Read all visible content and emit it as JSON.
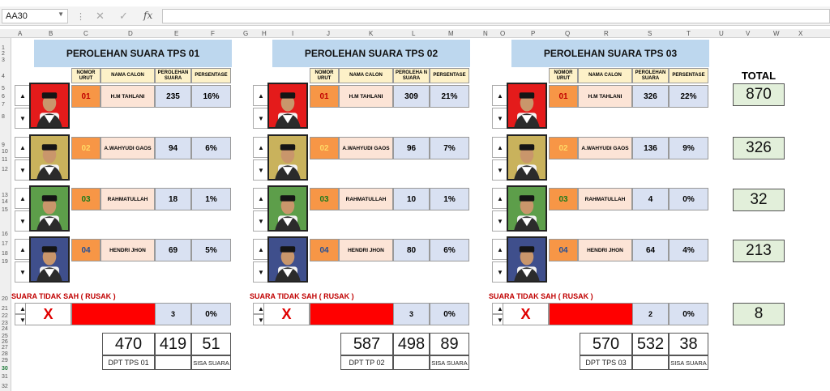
{
  "formula_bar": {
    "name_box": "AA30",
    "fx": "fx"
  },
  "columns": [
    "A",
    "B",
    "C",
    "D",
    "E",
    "F",
    "G",
    "H",
    "I",
    "J",
    "K",
    "L",
    "M",
    "N",
    "O",
    "P",
    "Q",
    "R",
    "S",
    "T",
    "U",
    "V",
    "W",
    "X"
  ],
  "rows": [
    "1",
    "2",
    "3",
    "4",
    "5",
    "6",
    "7",
    "8",
    "9",
    "10",
    "11",
    "12",
    "13",
    "14",
    "15",
    "16",
    "17",
    "18",
    "19",
    "20",
    "21",
    "22",
    "23",
    "24",
    "25",
    "26",
    "27",
    "28",
    "29",
    "30",
    "31",
    "32"
  ],
  "colors": {
    "title_bg": "#bdd7ee",
    "nomor_bg": "#f79646",
    "nama_bg": "#fce4d6",
    "value_bg": "#d9e1f2",
    "header_bg": "#fdf1c8",
    "total_bg": "#e2efda",
    "red": "#ff0000"
  },
  "blocks": [
    {
      "title": "PEROLEHAN SUARA TPS 01",
      "headers": {
        "nomor": "NOMOR URUT",
        "nama": "NAMA CALON",
        "perolehan": "PEROLEHAN SUARA",
        "persen": "PERSENTASE"
      },
      "candidates": [
        {
          "nomor": "01",
          "nama": "H.M TAHLANI",
          "suara": "235",
          "persen": "16%"
        },
        {
          "nomor": "02",
          "nama": "A.WAHYUDI GAOS",
          "suara": "94",
          "persen": "6%"
        },
        {
          "nomor": "03",
          "nama": "RAHMATULLAH",
          "suara": "18",
          "persen": "1%"
        },
        {
          "nomor": "04",
          "nama": "HENDRI JHON",
          "suara": "69",
          "persen": "5%"
        }
      ],
      "rusak_label": "SUARA TIDAK SAH ( RUSAK )",
      "rusak_x": "X",
      "rusak_suara": "3",
      "rusak_persen": "0%",
      "dpt": "470",
      "used": "419",
      "sisa": "51",
      "dpt_label": "DPT TPS 01",
      "sisa_label": "SISA SUARA"
    },
    {
      "title": "PEROLEHAN SUARA TPS 02",
      "headers": {
        "nomor": "NOMOR URUT",
        "nama": "NAMA CALON",
        "perolehan": "PEROLEHA N SUARA",
        "persen": "PERSENTASE"
      },
      "candidates": [
        {
          "nomor": "01",
          "nama": "H.M TAHLANI",
          "suara": "309",
          "persen": "21%"
        },
        {
          "nomor": "02",
          "nama": "A.WAHYUDI GAOS",
          "suara": "96",
          "persen": "7%"
        },
        {
          "nomor": "03",
          "nama": "RAHMATULLAH",
          "suara": "10",
          "persen": "1%"
        },
        {
          "nomor": "04",
          "nama": "HENDRI JHON",
          "suara": "80",
          "persen": "6%"
        }
      ],
      "rusak_label": "SUARA TIDAK SAH ( RUSAK )",
      "rusak_x": "X",
      "rusak_suara": "3",
      "rusak_persen": "0%",
      "dpt": "587",
      "used": "498",
      "sisa": "89",
      "dpt_label": "DPT TP 02",
      "sisa_label": "SISA SUARA"
    },
    {
      "title": "PEROLEHAN SUARA TPS 03",
      "headers": {
        "nomor": "NOMOR URUT",
        "nama": "NAMA CALON",
        "perolehan": "PEROLEHAN SUARA",
        "persen": "PERSENTASE"
      },
      "candidates": [
        {
          "nomor": "01",
          "nama": "H.M TAHLANI",
          "suara": "326",
          "persen": "22%"
        },
        {
          "nomor": "02",
          "nama": "A.WAHYUDI GAOS",
          "suara": "136",
          "persen": "9%"
        },
        {
          "nomor": "03",
          "nama": "RAHMATULLAH",
          "suara": "4",
          "persen": "0%"
        },
        {
          "nomor": "04",
          "nama": "HENDRI JHON",
          "suara": "64",
          "persen": "4%"
        }
      ],
      "rusak_label": "SUARA TIDAK SAH ( RUSAK )",
      "rusak_x": "X",
      "rusak_suara": "2",
      "rusak_persen": "0%",
      "dpt": "570",
      "used": "532",
      "sisa": "38",
      "dpt_label": "DPT TPS 03",
      "sisa_label": "SISA SUARA"
    }
  ],
  "total": {
    "title": "TOTAL",
    "values": [
      "870",
      "326",
      "32",
      "213",
      "8"
    ]
  },
  "photo_backgrounds": [
    "#e41b1b",
    "#c9b25c",
    "#5d9e4a",
    "#3f4f8c"
  ]
}
